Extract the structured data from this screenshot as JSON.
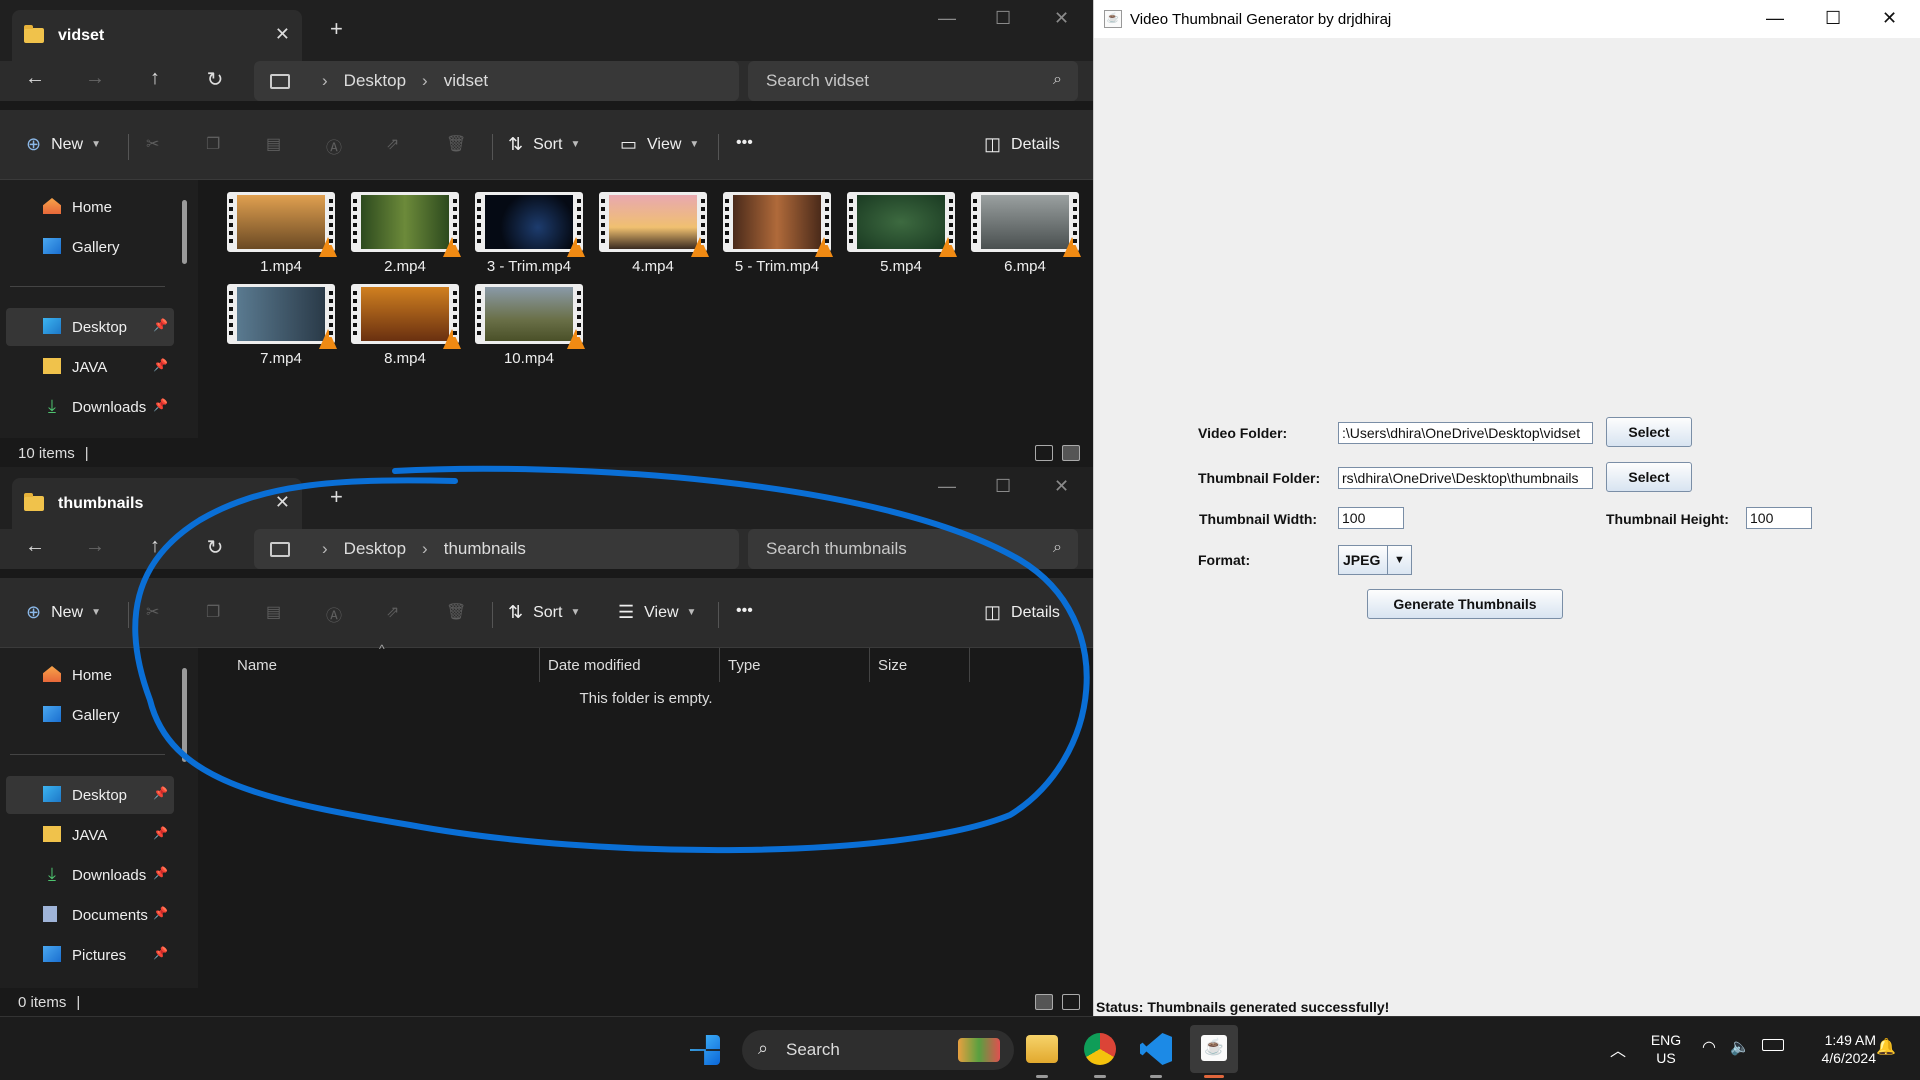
{
  "explorer_top": {
    "tab_title": "vidset",
    "path": [
      "Desktop",
      "vidset"
    ],
    "search_placeholder": "Search vidset",
    "toolbar": {
      "new": "New",
      "sort": "Sort",
      "view": "View",
      "more": "•••",
      "details": "Details"
    },
    "nav": [
      {
        "label": "Home",
        "icon": "home-icon",
        "pin": false
      },
      {
        "label": "Gallery",
        "icon": "gallery-icon",
        "pin": false
      },
      {
        "label": "Desktop",
        "icon": "desktop-icon",
        "pin": true,
        "selected": true
      },
      {
        "label": "JAVA",
        "icon": "folder-icon",
        "pin": true
      },
      {
        "label": "Downloads",
        "icon": "downloads-icon",
        "pin": true
      }
    ],
    "files": [
      "1.mp4",
      "2.mp4",
      "3 - Trim.mp4",
      "4.mp4",
      "5 - Trim.mp4",
      "5.mp4",
      "6.mp4",
      "7.mp4",
      "8.mp4",
      "10.mp4"
    ],
    "status": "10 items"
  },
  "explorer_bottom": {
    "tab_title": "thumbnails",
    "path": [
      "Desktop",
      "thumbnails"
    ],
    "search_placeholder": "Search thumbnails",
    "toolbar": {
      "new": "New",
      "sort": "Sort",
      "view": "View",
      "more": "•••",
      "details": "Details"
    },
    "nav": [
      {
        "label": "Home",
        "icon": "home-icon",
        "pin": false
      },
      {
        "label": "Gallery",
        "icon": "gallery-icon",
        "pin": false
      },
      {
        "label": "Desktop",
        "icon": "desktop-icon",
        "pin": true,
        "selected": true
      },
      {
        "label": "JAVA",
        "icon": "folder-icon",
        "pin": true
      },
      {
        "label": "Downloads",
        "icon": "downloads-icon",
        "pin": true
      },
      {
        "label": "Documents",
        "icon": "documents-icon",
        "pin": true
      },
      {
        "label": "Pictures",
        "icon": "pictures-icon",
        "pin": true
      }
    ],
    "columns": [
      "Name",
      "Date modified",
      "Type",
      "Size"
    ],
    "empty_message": "This folder is empty.",
    "status": "0 items"
  },
  "java_app": {
    "title": "Video Thumbnail Generator by drjdhiraj",
    "video_folder_label": "Video Folder:",
    "video_folder_value": ":\\Users\\dhira\\OneDrive\\Desktop\\vidset",
    "thumbnail_folder_label": "Thumbnail Folder:",
    "thumbnail_folder_value": "rs\\dhira\\OneDrive\\Desktop\\thumbnails",
    "select_label": "Select",
    "width_label": "Thumbnail Width:",
    "width_value": "100",
    "height_label": "Thumbnail Height:",
    "height_value": "100",
    "format_label": "Format:",
    "format_value": "JPEG",
    "generate_label": "Generate Thumbnails",
    "status": "Status: Thumbnails generated successfully!"
  },
  "taskbar": {
    "search_label": "Search",
    "lang_line1": "ENG",
    "lang_line2": "US",
    "time": "1:49 AM",
    "date": "4/6/2024"
  },
  "colors": {
    "annotation": "#0a6fd6",
    "accent": "#8bb8e8",
    "vlc": "#f08a13"
  }
}
